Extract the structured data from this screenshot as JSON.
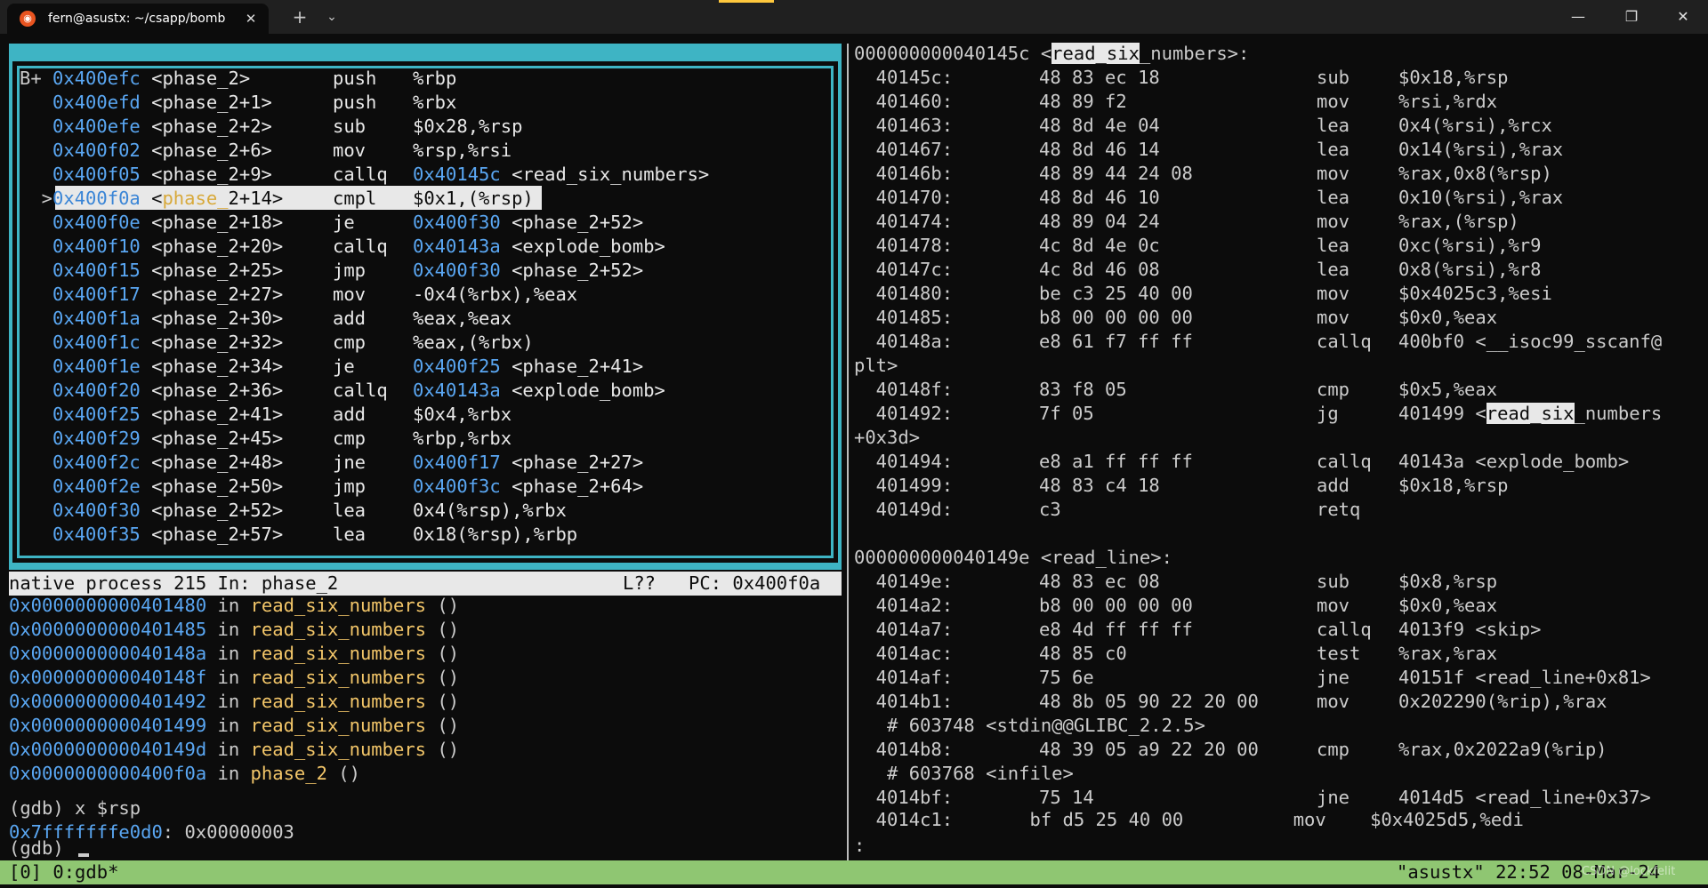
{
  "window": {
    "tab_title": "fern@asustx: ~/csapp/bomb",
    "tab_close": "✕",
    "new_tab": "+",
    "dropdown": "⌄",
    "minimize": "—",
    "maximize": "❐",
    "close": "✕"
  },
  "asm_pane": {
    "rows": [
      {
        "mark": "B+ ",
        "addr": "0x400efc",
        "sym": " <phase_2>      ",
        "op": "push   ",
        "args": "%rbp",
        "target": "",
        "tsym": ""
      },
      {
        "mark": "   ",
        "addr": "0x400efd",
        "sym": " <phase_2+1>    ",
        "op": "push   ",
        "args": "%rbx",
        "target": "",
        "tsym": ""
      },
      {
        "mark": "   ",
        "addr": "0x400efe",
        "sym": " <phase_2+2>    ",
        "op": "sub    ",
        "args": "$0x28,%rsp",
        "target": "",
        "tsym": ""
      },
      {
        "mark": "   ",
        "addr": "0x400f02",
        "sym": " <phase_2+6>    ",
        "op": "mov    ",
        "args": "%rsp,%rsi",
        "target": "",
        "tsym": ""
      },
      {
        "mark": "   ",
        "addr": "0x400f05",
        "sym": " <phase_2+9>    ",
        "op": "callq  ",
        "args": "",
        "target": "0x40145c",
        "tsym": " <read_six_numbers>"
      },
      {
        "mark": "  >",
        "addr": "0x400f0a",
        "sym": " <phase_2+14>   ",
        "op": "cmpl   ",
        "args": "$0x1,(%rsp)",
        "target": "",
        "tsym": ""
      },
      {
        "mark": "   ",
        "addr": "0x400f0e",
        "sym": " <phase_2+18>   ",
        "op": "je     ",
        "args": "",
        "target": "0x400f30",
        "tsym": " <phase_2+52>"
      },
      {
        "mark": "   ",
        "addr": "0x400f10",
        "sym": " <phase_2+20>   ",
        "op": "callq  ",
        "args": "",
        "target": "0x40143a",
        "tsym": " <explode_bomb>"
      },
      {
        "mark": "   ",
        "addr": "0x400f15",
        "sym": " <phase_2+25>   ",
        "op": "jmp    ",
        "args": "",
        "target": "0x400f30",
        "tsym": " <phase_2+52>"
      },
      {
        "mark": "   ",
        "addr": "0x400f17",
        "sym": " <phase_2+27>   ",
        "op": "mov    ",
        "args": "-0x4(%rbx),%eax",
        "target": "",
        "tsym": ""
      },
      {
        "mark": "   ",
        "addr": "0x400f1a",
        "sym": " <phase_2+30>   ",
        "op": "add    ",
        "args": "%eax,%eax",
        "target": "",
        "tsym": ""
      },
      {
        "mark": "   ",
        "addr": "0x400f1c",
        "sym": " <phase_2+32>   ",
        "op": "cmp    ",
        "args": "%eax,(%rbx)",
        "target": "",
        "tsym": ""
      },
      {
        "mark": "   ",
        "addr": "0x400f1e",
        "sym": " <phase_2+34>   ",
        "op": "je     ",
        "args": "",
        "target": "0x400f25",
        "tsym": " <phase_2+41>"
      },
      {
        "mark": "   ",
        "addr": "0x400f20",
        "sym": " <phase_2+36>   ",
        "op": "callq  ",
        "args": "",
        "target": "0x40143a",
        "tsym": " <explode_bomb>"
      },
      {
        "mark": "   ",
        "addr": "0x400f25",
        "sym": " <phase_2+41>   ",
        "op": "add    ",
        "args": "$0x4,%rbx",
        "target": "",
        "tsym": ""
      },
      {
        "mark": "   ",
        "addr": "0x400f29",
        "sym": " <phase_2+45>   ",
        "op": "cmp    ",
        "args": "%rbp,%rbx",
        "target": "",
        "tsym": ""
      },
      {
        "mark": "   ",
        "addr": "0x400f2c",
        "sym": " <phase_2+48>   ",
        "op": "jne    ",
        "args": "",
        "target": "0x400f17",
        "tsym": " <phase_2+27>"
      },
      {
        "mark": "   ",
        "addr": "0x400f2e",
        "sym": " <phase_2+50>   ",
        "op": "jmp    ",
        "args": "",
        "target": "0x400f3c",
        "tsym": " <phase_2+64>"
      },
      {
        "mark": "   ",
        "addr": "0x400f30",
        "sym": " <phase_2+52>   ",
        "op": "lea    ",
        "args": "0x4(%rsp),%rbx",
        "target": "",
        "tsym": ""
      },
      {
        "mark": "   ",
        "addr": "0x400f35",
        "sym": " <phase_2+57>   ",
        "op": "lea    ",
        "args": "0x18(%rsp),%rbp",
        "target": "",
        "tsym": ""
      }
    ],
    "status_left": "native process 215 In: phase_2",
    "status_right": "L??   PC: 0x400f0a"
  },
  "gdb_pane": {
    "frames": [
      {
        "addr": "0x0000000000401480",
        "fn": "read_six_numbers"
      },
      {
        "addr": "0x0000000000401485",
        "fn": "read_six_numbers"
      },
      {
        "addr": "0x000000000040148a",
        "fn": "read_six_numbers"
      },
      {
        "addr": "0x000000000040148f",
        "fn": "read_six_numbers"
      },
      {
        "addr": "0x0000000000401492",
        "fn": "read_six_numbers"
      },
      {
        "addr": "0x0000000000401499",
        "fn": "read_six_numbers"
      },
      {
        "addr": "0x000000000040149d",
        "fn": "read_six_numbers"
      },
      {
        "addr": "0x0000000000400f0a",
        "fn": "phase_2"
      }
    ],
    "in_word": " in ",
    "parens": " ()",
    "cmd": "(gdb) x $rsp",
    "mem_addr": "0x7fffffffe0d0",
    "mem_val": ": 0x00000003",
    "prompt": "(gdb) "
  },
  "objdump_pane": {
    "lines": [
      "000000000040145c <",
      "  40145c:\t48 83 ec 18          \tsub    $0x18,%rsp",
      "  401460:\t48 89 f2             \tmov    %rsi,%rdx",
      "  401463:\t48 8d 4e 04          \tlea    0x4(%rsi),%rcx",
      "  401467:\t48 8d 46 14          \tlea    0x14(%rsi),%rax",
      "  40146b:\t48 89 44 24 08       \tmov    %rax,0x8(%rsp)",
      "  401470:\t48 8d 46 10          \tlea    0x10(%rsi),%rax",
      "  401474:\t48 89 04 24          \tmov    %rax,(%rsp)",
      "  401478:\t4c 8d 4e 0c          \tlea    0xc(%rsi),%r9",
      "  40147c:\t4c 8d 46 08          \tlea    0x8(%rsi),%r8",
      "  401480:\tbe c3 25 40 00       \tmov    $0x4025c3,%esi",
      "  401485:\tb8 00 00 00 00       \tmov    $0x0,%eax",
      "  40148a:\te8 61 f7 ff ff       \tcallq  400bf0 <__isoc99_sscanf@",
      "plt>",
      "  40148f:\t83 f8 05             \tcmp    $0x5,%eax",
      "  401492:\t7f 05                \tjg     401499 <",
      "+0x3d>",
      "  401494:\te8 a1 ff ff ff       \tcallq  40143a <explode_bomb>",
      "  401499:\t48 83 c4 18          \tadd    $0x18,%rsp",
      "  40149d:\tc3                   \tretq",
      "",
      "000000000040149e <read_line>:",
      "  40149e:\t48 83 ec 08          \tsub    $0x8,%rsp",
      "  4014a2:\tb8 00 00 00 00       \tmov    $0x0,%eax",
      "  4014a7:\te8 4d ff ff ff       \tcallq  4013f9 <skip>",
      "  4014ac:\t48 85 c0             \ttest   %rax,%rax",
      "  4014af:\t75 6e                \tjne    40151f <read_line+0x81>",
      "  4014b1:\t48 8b 05 90 22 20 00 \tmov    0x202290(%rip),%rax",
      "   # 603748 <stdin@@GLIBC_2.2.5>",
      "  4014b8:\t48 39 05 a9 22 20 00 \tcmp    %rax,0x2022a9(%rip)",
      "   # 603768 <infile>",
      "  4014bf:\t75 14                \tjne    4014d5 <read_line+0x37>",
      "  4014c1:\tbf d5 25 40 00       \tmov    $0x4025d5,%edi",
      ":"
    ],
    "hdr_sel": "read_six",
    "hdr_rest": "_numbers>:",
    "jg_sel": "read_six",
    "jg_rest": "_numbers"
  },
  "tmux": {
    "left": "[0] 0:gdb*",
    "right": "\"asustx\" 22:52 08-Mar-24",
    "watermark": "CSDN @lockfelit"
  }
}
